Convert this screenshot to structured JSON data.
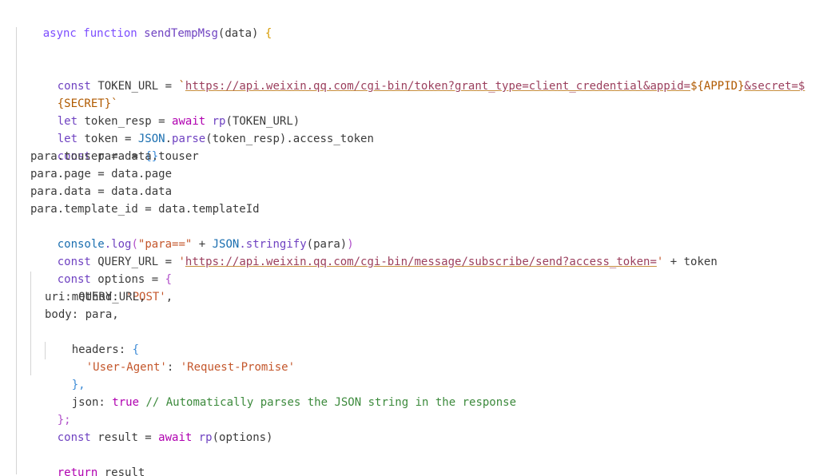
{
  "code": {
    "func_kw": "async function",
    "func_name": "sendTempMsg",
    "func_params": "(data)",
    "open_brace": "{",
    "l_token_url_decl": "const",
    "l_token_url_name": "TOKEN_URL",
    "l_token_url_eq": " = ",
    "l_token_url_tick": "`",
    "l_token_url_str": "https://api.weixin.qq.com/cgi-bin/token?grant_type=client_credential&appid=",
    "l_token_url_t1": "${APPID}",
    "l_token_url_str2": "&secret=$",
    "l_token_url_t2": "{SECRET}",
    "l_token_url_tick2": "`",
    "l_resp_decl": "let",
    "l_resp_rest_a": " token_resp = ",
    "l_resp_await": "await",
    "l_resp_fn": "rp",
    "l_resp_arg": "(TOKEN_URL)",
    "l_token_decl": "let",
    "l_token_rest": " token = ",
    "l_token_obj": "JSON",
    "l_token_dot": ".",
    "l_token_fn": "parse",
    "l_token_arg": "(token_resp).access_token",
    "l_para_decl": "const",
    "l_para_rest": " para = ",
    "l_para_obj": "{}",
    "l_touser": "para.touser = data.touser",
    "l_page": "para.page = data.page",
    "l_data": "para.data = data.data",
    "l_template": "para.template_id = data.templateId",
    "l_log_obj": "console",
    "l_log_fn": ".log",
    "l_log_open": "(",
    "l_log_str": "\"para==\"",
    "l_log_plus": " + ",
    "l_log_json": "JSON",
    "l_log_fn2": ".stringify",
    "l_log_arg": "(para)",
    "l_log_close": ")",
    "l_query_decl": "const",
    "l_query_name": " QUERY_URL = ",
    "l_query_q": "'",
    "l_query_url": "https://api.weixin.qq.com/cgi-bin/message/subscribe/send?access_token=",
    "l_query_q2": "'",
    "l_query_rest": " + token",
    "l_options_decl": "const",
    "l_options_rest": " options = ",
    "l_options_brace": "{",
    "l_method_key": "method: ",
    "l_method_val": "'POST'",
    "l_method_comma": ",",
    "l_uri": "uri: QUERY_URL,",
    "l_body": "body: para,",
    "l_headers_key": "headers: ",
    "l_headers_brace": "{",
    "l_ua_key": "'User-Agent'",
    "l_ua_colon": ": ",
    "l_ua_val": "'Request-Promise'",
    "l_headers_close": "},",
    "l_json_key": "json: ",
    "l_json_val": "true",
    "l_json_comment": " // Automatically parses the JSON string in the response",
    "l_options_close": "};",
    "l_result_decl": "const",
    "l_result_rest": " result = ",
    "l_result_await": "await",
    "l_result_fn": " rp",
    "l_result_arg": "(options)",
    "l_return_kw": "return",
    "l_return_rest": " result"
  }
}
